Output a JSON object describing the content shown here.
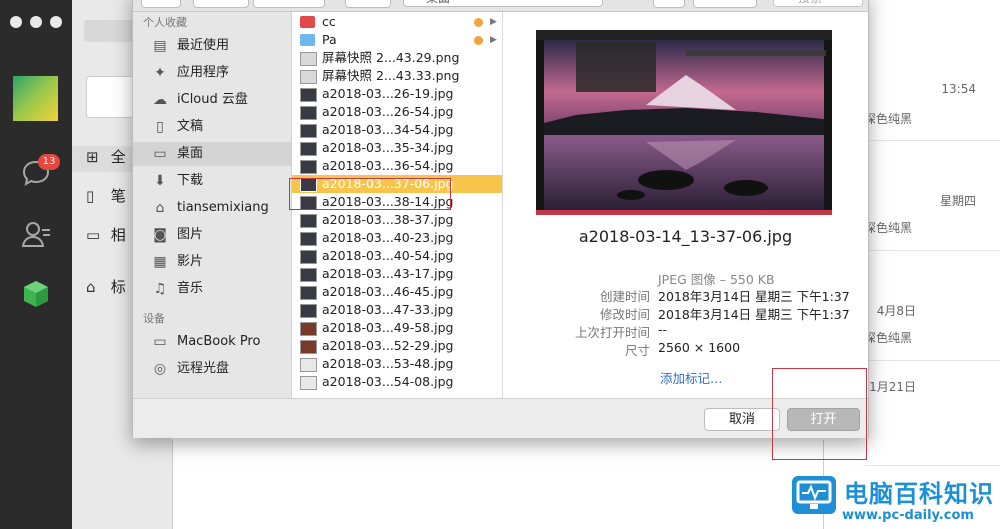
{
  "wechat": {
    "unread_badge": "13",
    "nav": [
      "全",
      "笔",
      "相",
      "标"
    ],
    "right_items": [
      {
        "time": "13:54",
        "desc": "深色纯黑"
      },
      {
        "time": "星期四",
        "desc": "深色纯黑"
      },
      {
        "time": "4月8日",
        "desc": "深色纯黑"
      },
      {
        "time": "1月21日",
        "desc": ""
      }
    ]
  },
  "dialog": {
    "toolbar": {
      "location": "桌面",
      "search_placeholder": "搜索"
    },
    "sidebar": {
      "favorites_header": "个人收藏",
      "favorites": [
        {
          "label": "最近使用",
          "icon": "recents-icon"
        },
        {
          "label": "应用程序",
          "icon": "applications-icon"
        },
        {
          "label": "iCloud 云盘",
          "icon": "icloud-icon"
        },
        {
          "label": "文稿",
          "icon": "documents-icon"
        },
        {
          "label": "桌面",
          "icon": "desktop-icon"
        },
        {
          "label": "下载",
          "icon": "downloads-icon"
        },
        {
          "label": "tiansemixiang",
          "icon": "home-icon"
        },
        {
          "label": "图片",
          "icon": "pictures-icon"
        },
        {
          "label": "影片",
          "icon": "movies-icon"
        },
        {
          "label": "音乐",
          "icon": "music-icon"
        }
      ],
      "devices_header": "设备",
      "devices": [
        {
          "label": "MacBook Pro",
          "icon": "laptop-icon"
        },
        {
          "label": "远程光盘",
          "icon": "disc-icon"
        }
      ],
      "selected": "桌面"
    },
    "files": [
      "cc",
      "Pa",
      "屏幕快照 2...43.29.png",
      "屏幕快照 2...43.33.png",
      "a2018-03...26-19.jpg",
      "a2018-03...26-54.jpg",
      "a2018-03...34-54.jpg",
      "a2018-03...35-34.jpg",
      "a2018-03...36-54.jpg",
      "a2018-03...37-06.jpg",
      "a2018-03...38-14.jpg",
      "a2018-03...38-37.jpg",
      "a2018-03...40-23.jpg",
      "a2018-03...40-54.jpg",
      "a2018-03...43-17.jpg",
      "a2018-03...46-45.jpg",
      "a2018-03...47-33.jpg",
      "a2018-03...49-58.jpg",
      "a2018-03...52-29.jpg",
      "a2018-03...53-48.jpg",
      "a2018-03...54-08.jpg"
    ],
    "selected_file_index": 9,
    "preview": {
      "filename": "a2018-03-14_13-37-06.jpg",
      "kind": "JPEG 图像 – 550 KB",
      "created_label": "创建时间",
      "created": "2018年3月14日 星期三 下午1:37",
      "modified_label": "修改时间",
      "modified": "2018年3月14日 星期三 下午1:37",
      "last_opened_label": "上次打开时间",
      "last_opened": "--",
      "dimensions_label": "尺寸",
      "dimensions": "2560 × 1600",
      "add_tags": "添加标记…"
    },
    "buttons": {
      "cancel": "取消",
      "open": "打开"
    }
  },
  "watermark": {
    "title": "电脑百科知识",
    "url": "www.pc-daily.com"
  },
  "colors": {
    "selection": "#f6c54a",
    "annotation_red": "#c0394b",
    "link_blue": "#2f6fd1",
    "tag_orange": "#f0a43a"
  }
}
